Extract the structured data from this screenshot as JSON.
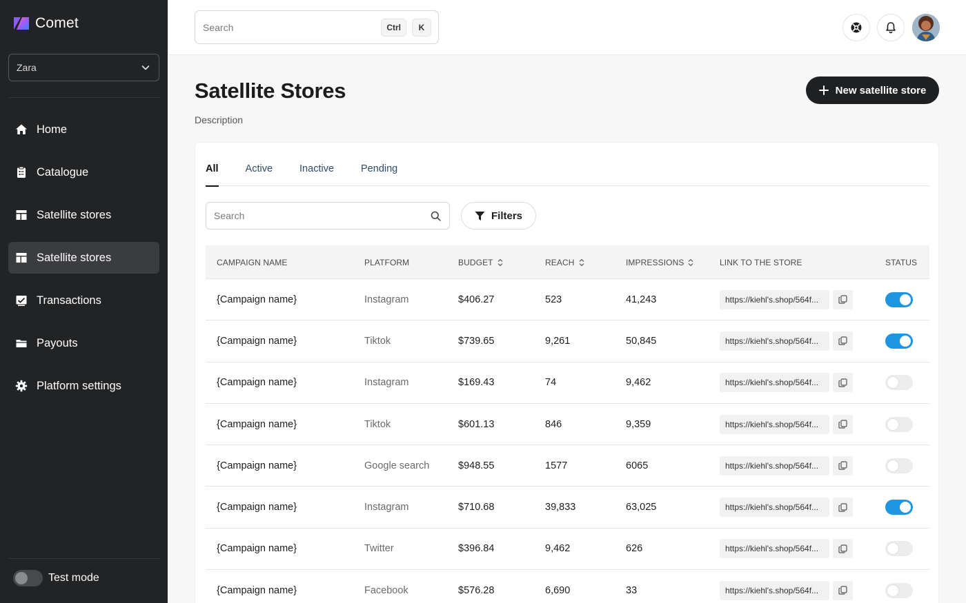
{
  "app": {
    "name": "Comet"
  },
  "sidebar": {
    "workspace": "Zara",
    "items": [
      {
        "label": "Home",
        "icon": "home-icon",
        "active": false
      },
      {
        "label": "Catalogue",
        "icon": "clipboard-icon",
        "active": false
      },
      {
        "label": "Satellite stores",
        "icon": "layout-icon",
        "active": false
      },
      {
        "label": "Satellite stores",
        "icon": "layout-icon",
        "active": true
      },
      {
        "label": "Transactions",
        "icon": "chart-check-icon",
        "active": false
      },
      {
        "label": "Payouts",
        "icon": "folder-icon",
        "active": false
      },
      {
        "label": "Platform settings",
        "icon": "gear-icon",
        "active": false
      }
    ],
    "test_mode_label": "Test mode",
    "test_mode_on": false
  },
  "topbar": {
    "search_placeholder": "Search",
    "kbd_ctrl": "Ctrl",
    "kbd_k": "K"
  },
  "header": {
    "title": "Satellite Stores",
    "description": "Description",
    "new_button": "New satellite store"
  },
  "tabs": [
    "All",
    "Active",
    "Inactive",
    "Pending"
  ],
  "table_search_placeholder": "Search",
  "filters_label": "Filters",
  "columns": [
    "CAMPAIGN NAME",
    "PLATFORM",
    "BUDGET",
    "REACH",
    "IMPRESSIONS",
    "LINK TO THE STORE",
    "STATUS"
  ],
  "rows": [
    {
      "name": "{Campaign name}",
      "platform": "Instagram",
      "budget": "$406.27",
      "reach": "523",
      "impressions": "41,243",
      "link": "https://kiehl's.shop/564f...",
      "status": true
    },
    {
      "name": "{Campaign name}",
      "platform": "Tiktok",
      "budget": "$739.65",
      "reach": "9,261",
      "impressions": "50,845",
      "link": "https://kiehl's.shop/564f...",
      "status": true
    },
    {
      "name": "{Campaign name}",
      "platform": "Instagram",
      "budget": "$169.43",
      "reach": "74",
      "impressions": "9,462",
      "link": "https://kiehl's.shop/564f...",
      "status": false
    },
    {
      "name": "{Campaign name}",
      "platform": "Tiktok",
      "budget": "$601.13",
      "reach": "846",
      "impressions": "9,359",
      "link": "https://kiehl's.shop/564f...",
      "status": false
    },
    {
      "name": "{Campaign name}",
      "platform": "Google search",
      "budget": "$948.55",
      "reach": "1577",
      "impressions": "6065",
      "link": "https://kiehl's.shop/564f...",
      "status": false
    },
    {
      "name": "{Campaign name}",
      "platform": "Instagram",
      "budget": "$710.68",
      "reach": "39,833",
      "impressions": "63,025",
      "link": "https://kiehl's.shop/564f...",
      "status": true
    },
    {
      "name": "{Campaign name}",
      "platform": "Twitter",
      "budget": "$396.84",
      "reach": "9,462",
      "impressions": "626",
      "link": "https://kiehl's.shop/564f...",
      "status": false
    },
    {
      "name": "{Campaign name}",
      "platform": "Facebook",
      "budget": "$576.28",
      "reach": "6,690",
      "impressions": "33",
      "link": "https://kiehl's.shop/564f...",
      "status": false
    }
  ],
  "colors": {
    "sidebar_bg": "#222324",
    "accent_toggle": "#1e95e0",
    "primary_button": "#1f2022"
  }
}
